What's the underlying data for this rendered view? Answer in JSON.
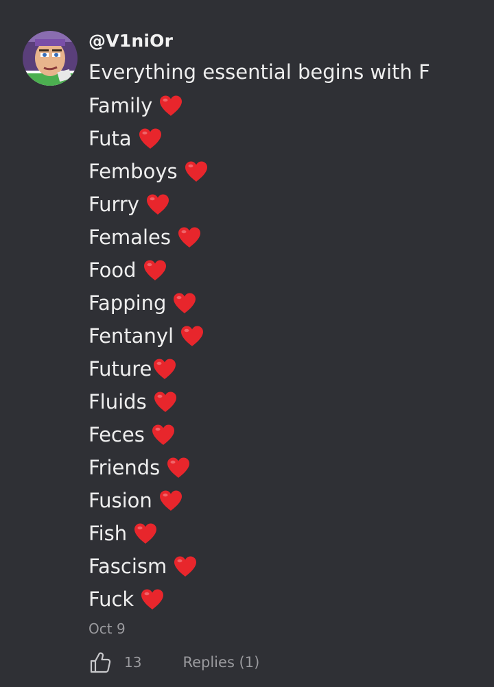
{
  "comment": {
    "author": "@V1niOr",
    "lines": [
      {
        "text": "Everything essential begins with F",
        "heart": false
      },
      {
        "text": "Family",
        "heart": true
      },
      {
        "text": "Futa",
        "heart": true
      },
      {
        "text": "Femboys",
        "heart": true
      },
      {
        "text": "Furry",
        "heart": true
      },
      {
        "text": "Females",
        "heart": true
      },
      {
        "text": "Food",
        "heart": true
      },
      {
        "text": "Fapping",
        "heart": true
      },
      {
        "text": "Fentanyl",
        "heart": true
      },
      {
        "text": "Future",
        "heart": true,
        "no_space": true
      },
      {
        "text": "Fluids",
        "heart": true
      },
      {
        "text": "Feces",
        "heart": true
      },
      {
        "text": "Friends",
        "heart": true
      },
      {
        "text": "Fusion",
        "heart": true
      },
      {
        "text": "Fish",
        "heart": true
      },
      {
        "text": "Fascism",
        "heart": true
      },
      {
        "text": "Fuck",
        "heart": true
      }
    ],
    "date": "Oct 9",
    "like_count": "13",
    "replies_label": "Replies (1)",
    "heart_icon": "red-heart-emoji",
    "colors": {
      "background": "#2f3035",
      "text": "#eeeeee",
      "muted": "#9a9a9e",
      "heart": "#e8262c"
    }
  }
}
